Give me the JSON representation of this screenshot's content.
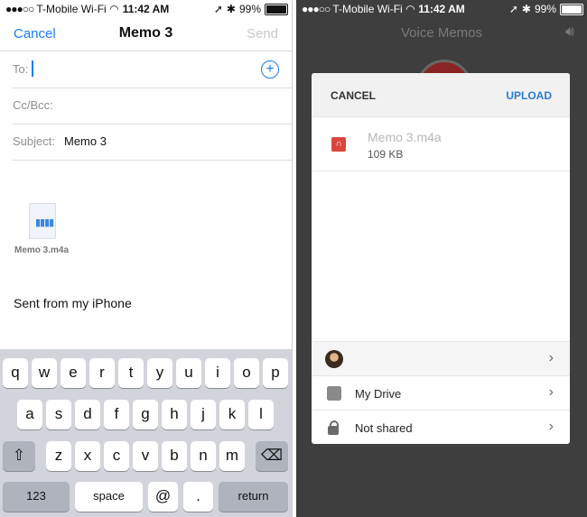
{
  "left": {
    "status": {
      "carrier": "T-Mobile Wi-Fi",
      "time": "11:42 AM",
      "battery": "99%"
    },
    "nav": {
      "cancel": "Cancel",
      "title": "Memo 3",
      "send": "Send"
    },
    "fields": {
      "to_label": "To:",
      "ccbcc_label": "Cc/Bcc:",
      "subject_label": "Subject:",
      "subject_value": "Memo 3"
    },
    "attachment": {
      "name": "Memo 3.m4a"
    },
    "signature": "Sent from my iPhone",
    "keyboard": {
      "row1": [
        "q",
        "w",
        "e",
        "r",
        "t",
        "y",
        "u",
        "i",
        "o",
        "p"
      ],
      "row2": [
        "a",
        "s",
        "d",
        "f",
        "g",
        "h",
        "j",
        "k",
        "l"
      ],
      "row3": [
        "z",
        "x",
        "c",
        "v",
        "b",
        "n",
        "m"
      ],
      "numbers": "123",
      "space": "space",
      "at": "@",
      "dot": ".",
      "return": "return"
    }
  },
  "right": {
    "status": {
      "carrier": "T-Mobile Wi-Fi",
      "time": "11:42 AM",
      "battery": "99%"
    },
    "app_title": "Voice Memos",
    "dialog": {
      "cancel": "CANCEL",
      "upload": "UPLOAD",
      "file_name": "Memo 3.m4a",
      "file_size": "109 KB",
      "rows": [
        {
          "label": ""
        },
        {
          "label": "My Drive"
        },
        {
          "label": "Not shared"
        }
      ]
    }
  },
  "colors": {
    "accent": "#1a7cf4",
    "upload": "#2a7bd4",
    "file_icon": "#d9473c"
  }
}
